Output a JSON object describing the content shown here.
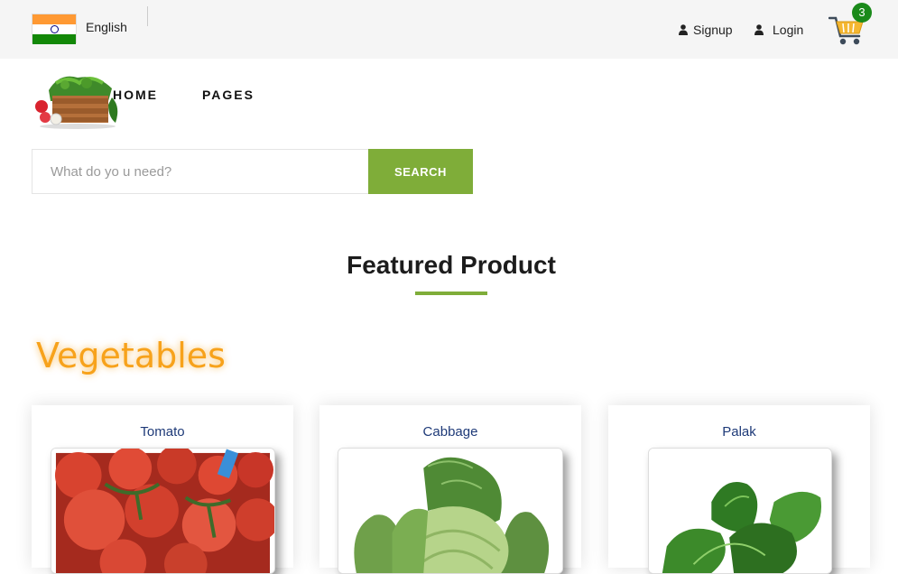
{
  "header": {
    "language": "English",
    "signup_label": "Signup",
    "login_label": "Login",
    "cart_count": "3",
    "icons": {
      "flag": "india-flag-icon",
      "user": "user-icon",
      "cart": "shopping-cart-icon"
    }
  },
  "nav": {
    "items": [
      {
        "label": "HOME"
      },
      {
        "label": "PAGES"
      }
    ]
  },
  "search": {
    "placeholder": "What do yo u need?",
    "button_label": "SEARCH"
  },
  "featured": {
    "title": "Featured Product",
    "category": "Vegetables",
    "products": [
      {
        "name": "Tomato"
      },
      {
        "name": "Cabbage"
      },
      {
        "name": "Palak"
      }
    ]
  },
  "colors": {
    "accent": "#7fad39",
    "category": "#f7a21b",
    "product_name": "#1e3a78",
    "badge": "#1a8a1a"
  }
}
